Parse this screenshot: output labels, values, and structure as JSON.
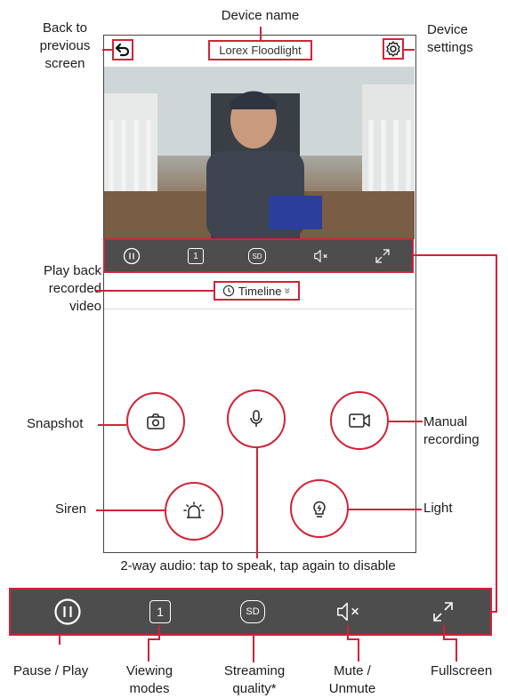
{
  "header": {
    "device_name": "Lorex Floodlight"
  },
  "timeline": {
    "label": "Timeline",
    "chevron": "»"
  },
  "annotations": {
    "device_name": "Device name",
    "back_line1": "Back to",
    "back_line2": "previous",
    "back_line3": "screen",
    "settings_line1": "Device",
    "settings_line2": "settings",
    "playback_line1": "Play back",
    "playback_line2": "recorded",
    "playback_line3": "video",
    "snapshot": "Snapshot",
    "manual_line1": "Manual",
    "manual_line2": "recording",
    "siren": "Siren",
    "light": "Light",
    "audio": "2-way audio: tap to speak, tap again to disable",
    "pause": "Pause / Play",
    "viewing_line1": "Viewing",
    "viewing_line2": "modes",
    "streaming_line1": "Streaming",
    "streaming_line2": "quality*",
    "mute_line1": "Mute /",
    "mute_line2": "Unmute",
    "fullscreen": "Fullscreen"
  },
  "controls": {
    "viewing_mode_value": "1",
    "quality_value": "SD",
    "mute_symbol": "×"
  },
  "colors": {
    "accent": "#d32237",
    "bar": "#4d4d4d"
  },
  "icons": [
    "back-icon",
    "gear-icon",
    "pause-icon",
    "viewing-mode-icon",
    "sd-icon",
    "mute-icon",
    "fullscreen-icon",
    "clock-icon",
    "camera-icon",
    "microphone-icon",
    "video-record-icon",
    "siren-icon",
    "light-bulb-icon"
  ]
}
